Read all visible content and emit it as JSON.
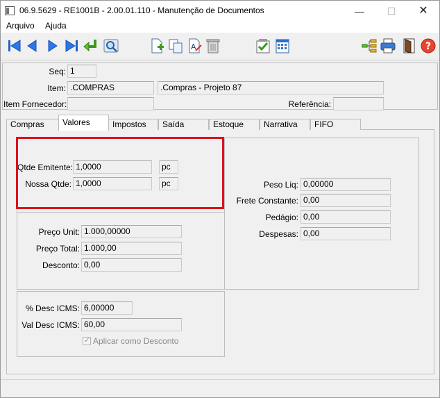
{
  "window": {
    "title": "06.9.5629 - RE1001B - 2.00.01.110 - Manutenção de Documentos",
    "minimize": "—",
    "maximize": "☐",
    "close": "✕"
  },
  "menu": {
    "items": [
      {
        "label": "Arquivo"
      },
      {
        "label": "Ajuda"
      }
    ]
  },
  "toolbar": {
    "icons": [
      "first-icon",
      "previous-icon",
      "next-icon",
      "last-icon",
      "goto-icon",
      "search-icon",
      "new-icon",
      "copy-icon",
      "edit-icon",
      "delete-icon",
      "confirm-icon",
      "calendar-icon",
      "tree-icon",
      "print-icon",
      "exit-icon",
      "help-icon"
    ]
  },
  "header": {
    "seq_label": "Seq:",
    "seq_value": "1",
    "item_label": "Item:",
    "item_code": ".COMPRAS",
    "item_desc": ".Compras - Projeto 87",
    "item_fornecedor_label": "Item Fornecedor:",
    "item_fornecedor_value": "",
    "referencia_label": "Referência:",
    "referencia_value": ""
  },
  "tabs": [
    {
      "label": "Compras",
      "active": false
    },
    {
      "label": "Valores",
      "active": true
    },
    {
      "label": "Impostos",
      "active": false
    },
    {
      "label": "Saída",
      "active": false
    },
    {
      "label": "Estoque",
      "active": false
    },
    {
      "label": "Narrativa",
      "active": false
    },
    {
      "label": "FIFO",
      "active": false
    }
  ],
  "valores": {
    "qtde_emitente_label": "Qtde Emitente:",
    "qtde_emitente_value": "1,0000",
    "qtde_emitente_unit": "pc",
    "nossa_qtde_label": "Nossa Qtde:",
    "nossa_qtde_value": "1,0000",
    "nossa_qtde_unit": "pc",
    "preco_unit_label": "Preço Unit:",
    "preco_unit_value": "1.000,00000",
    "preco_total_label": "Preço Total:",
    "preco_total_value": "1.000,00",
    "desconto_label": "Desconto:",
    "desconto_value": "0,00",
    "pct_desc_icms_label": "% Desc ICMS:",
    "pct_desc_icms_value": "6,00000",
    "val_desc_icms_label": "Val Desc ICMS:",
    "val_desc_icms_value": "60,00",
    "aplicar_desconto_label": "Aplicar como Desconto",
    "aplicar_desconto_checked": true,
    "peso_liq_label": "Peso Liq:",
    "peso_liq_value": "0,00000",
    "frete_label": "Frete Constante:",
    "frete_value": "0,00",
    "pedagio_label": "Pedágio:",
    "pedagio_value": "0,00",
    "despesas_label": "Despesas:",
    "despesas_value": "0,00"
  },
  "colors": {
    "highlight": "#e0101a",
    "panel": "#f0f0f0"
  }
}
